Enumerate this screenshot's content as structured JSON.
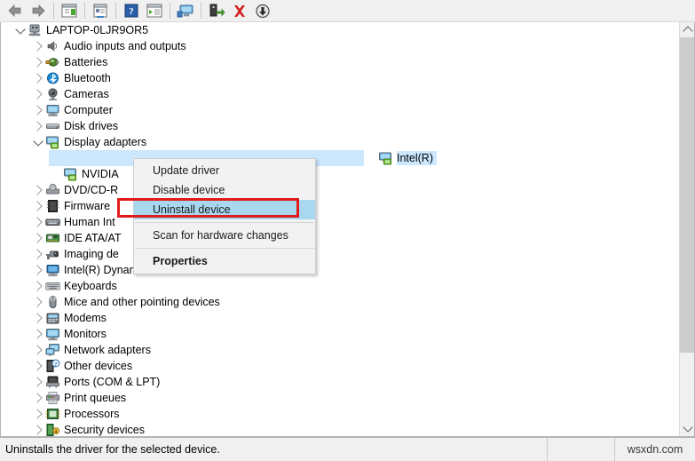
{
  "toolbar": {
    "buttons": [
      {
        "name": "back-button",
        "icon": "left-arrow-icon",
        "label": "Back"
      },
      {
        "name": "forward-button",
        "icon": "right-arrow-icon",
        "label": "Forward"
      },
      {
        "name": "show-hide-console-tree-button",
        "icon": "console-tree-icon",
        "label": "Show/Hide Console Tree"
      },
      {
        "name": "properties-button",
        "icon": "properties-icon",
        "label": "Properties"
      },
      {
        "name": "help-button",
        "icon": "help-question-icon",
        "label": "Help"
      },
      {
        "name": "view-button",
        "icon": "view-list-icon",
        "label": "View"
      },
      {
        "name": "scan-hardware-changes-button",
        "icon": "scan-monitor-icon",
        "label": "Scan for hardware changes"
      },
      {
        "name": "update-driver-button",
        "icon": "update-driver-icon",
        "label": "Update driver"
      },
      {
        "name": "uninstall-device-button",
        "icon": "red-x-icon",
        "label": "Uninstall device"
      },
      {
        "name": "disable-device-button",
        "icon": "down-arrow-circle-icon",
        "label": "Disable device"
      }
    ]
  },
  "tree": {
    "root": {
      "label": "LAPTOP-0LJR9OR5",
      "icon": "computer-root-icon",
      "expanded": true
    },
    "items": [
      {
        "label": "Audio inputs and outputs",
        "icon": "speaker-icon",
        "indent": 1,
        "expanded": false,
        "selected": false
      },
      {
        "label": "Batteries",
        "icon": "battery-icon",
        "indent": 1,
        "expanded": false,
        "selected": false
      },
      {
        "label": "Bluetooth",
        "icon": "bluetooth-icon",
        "indent": 1,
        "expanded": false,
        "selected": false
      },
      {
        "label": "Cameras",
        "icon": "camera-icon",
        "indent": 1,
        "expanded": false,
        "selected": false
      },
      {
        "label": "Computer",
        "icon": "computer-icon",
        "indent": 1,
        "expanded": false,
        "selected": false
      },
      {
        "label": "Disk drives",
        "icon": "disk-drive-icon",
        "indent": 1,
        "expanded": false,
        "selected": false
      },
      {
        "label": "Display adapters",
        "icon": "display-adapter-icon",
        "indent": 1,
        "expanded": true,
        "selected": false
      },
      {
        "label": "Intel(R)",
        "icon": "display-adapter-icon",
        "indent": 2,
        "expanded": null,
        "selected": true
      },
      {
        "label": "NVIDIA",
        "icon": "display-adapter-icon",
        "indent": 2,
        "expanded": null,
        "selected": false
      },
      {
        "label": "DVD/CD-R",
        "icon": "dvd-drive-icon",
        "indent": 1,
        "expanded": false,
        "selected": false
      },
      {
        "label": "Firmware",
        "icon": "firmware-icon",
        "indent": 1,
        "expanded": false,
        "selected": false
      },
      {
        "label": "Human Int",
        "icon": "hid-icon",
        "indent": 1,
        "expanded": false,
        "selected": false
      },
      {
        "label": "IDE ATA/AT",
        "icon": "ide-controller-icon",
        "indent": 1,
        "expanded": false,
        "selected": false
      },
      {
        "label": "Imaging de",
        "icon": "imaging-device-icon",
        "indent": 1,
        "expanded": false,
        "selected": false
      },
      {
        "label": "Intel(R) Dynamic Platform and Thermal Framework",
        "icon": "thermal-framework-icon",
        "indent": 1,
        "expanded": false,
        "selected": false
      },
      {
        "label": "Keyboards",
        "icon": "keyboard-icon",
        "indent": 1,
        "expanded": false,
        "selected": false
      },
      {
        "label": "Mice and other pointing devices",
        "icon": "mouse-icon",
        "indent": 1,
        "expanded": false,
        "selected": false
      },
      {
        "label": "Modems",
        "icon": "modem-icon",
        "indent": 1,
        "expanded": false,
        "selected": false
      },
      {
        "label": "Monitors",
        "icon": "monitor-icon",
        "indent": 1,
        "expanded": false,
        "selected": false
      },
      {
        "label": "Network adapters",
        "icon": "network-adapter-icon",
        "indent": 1,
        "expanded": false,
        "selected": false
      },
      {
        "label": "Other devices",
        "icon": "other-device-icon",
        "indent": 1,
        "expanded": false,
        "selected": false
      },
      {
        "label": "Ports (COM & LPT)",
        "icon": "ports-icon",
        "indent": 1,
        "expanded": false,
        "selected": false
      },
      {
        "label": "Print queues",
        "icon": "printer-icon",
        "indent": 1,
        "expanded": false,
        "selected": false
      },
      {
        "label": "Processors",
        "icon": "processor-icon",
        "indent": 1,
        "expanded": false,
        "selected": false
      },
      {
        "label": "Security devices",
        "icon": "security-device-icon",
        "indent": 1,
        "expanded": false,
        "selected": false
      }
    ]
  },
  "context_menu": {
    "items": [
      {
        "label": "Update driver",
        "type": "item",
        "bold": false,
        "highlighted": false
      },
      {
        "label": "Disable device",
        "type": "item",
        "bold": false,
        "highlighted": false
      },
      {
        "label": "Uninstall device",
        "type": "item",
        "bold": false,
        "highlighted": true
      },
      {
        "label": "",
        "type": "separator"
      },
      {
        "label": "Scan for hardware changes",
        "type": "item",
        "bold": false,
        "highlighted": false
      },
      {
        "label": "",
        "type": "separator"
      },
      {
        "label": "Properties",
        "type": "item",
        "bold": true,
        "highlighted": false
      }
    ]
  },
  "annotation": {
    "highlight_color": "#e01b1b",
    "target_label": "Uninstall device"
  },
  "statusbar": {
    "message": "Uninstalls the driver for the selected device.",
    "watermark": "wsxdn.com"
  },
  "colors": {
    "selection": "#cce8ff",
    "menu_highlight": "#a8d8f0",
    "annotation_red": "#e01b1b",
    "toolbar_bg": "#f0f0f0"
  }
}
